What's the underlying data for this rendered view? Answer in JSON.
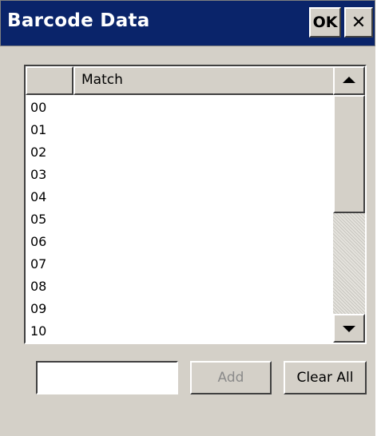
{
  "window": {
    "title": "Barcode Data",
    "ok_label": "OK",
    "close_label": "✕"
  },
  "table": {
    "columns": [
      "",
      "Match"
    ],
    "rows": [
      "00",
      "01",
      "02",
      "03",
      "04",
      "05",
      "06",
      "07",
      "08",
      "09",
      "10"
    ]
  },
  "form": {
    "input_value": "",
    "add_label": "Add",
    "add_enabled": false,
    "clear_label": "Clear All"
  },
  "colors": {
    "titlebar": "#0a246a",
    "face": "#d4d0c8",
    "disabled_text": "#8a8a8a"
  },
  "icons": {
    "scroll_up": "arrow-up-icon",
    "scroll_down": "arrow-down-icon",
    "close": "close-icon"
  }
}
